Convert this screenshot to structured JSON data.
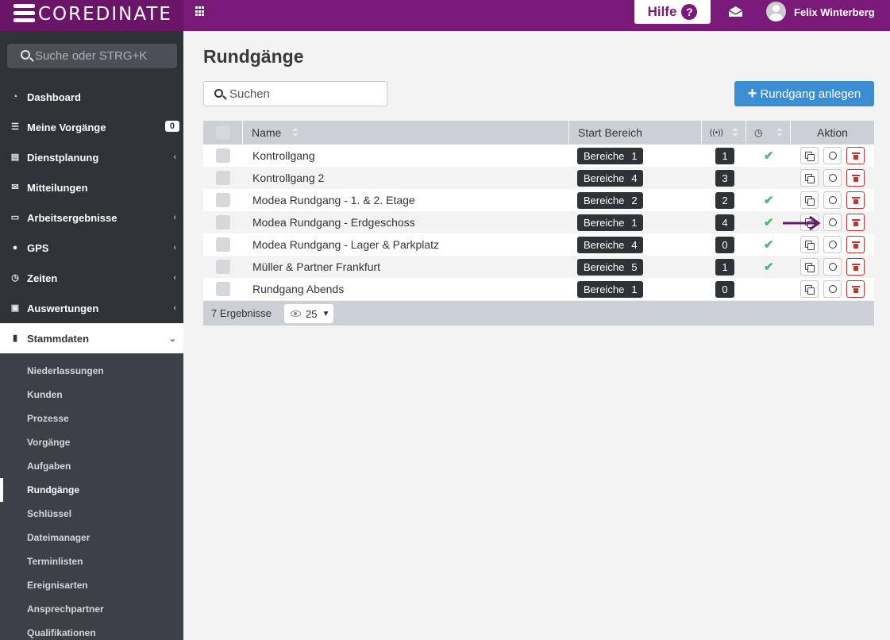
{
  "header": {
    "brand": "COREDINATE",
    "help_label": "Hilfe",
    "help_icon": "question-circle-icon",
    "user_name": "Felix Winterberg"
  },
  "sidebar": {
    "search_placeholder": "Suche oder STRG+K",
    "items": [
      {
        "label": "Dashboard",
        "icon": "dashboard-icon"
      },
      {
        "label": "Meine Vorgänge",
        "icon": "list-icon",
        "badge": "0"
      },
      {
        "label": "Dienstplanung",
        "icon": "calendar-icon"
      },
      {
        "label": "Mitteilungen",
        "icon": "envelope-icon"
      },
      {
        "label": "Arbeitsergebnisse",
        "icon": "monitor-icon"
      },
      {
        "label": "GPS",
        "icon": "map-marker-icon"
      },
      {
        "label": "Zeiten",
        "icon": "clock-icon"
      },
      {
        "label": "Auswertungen",
        "icon": "report-icon"
      },
      {
        "label": "Stammdaten",
        "icon": "book-icon"
      }
    ],
    "subitems": [
      "Niederlassungen",
      "Kunden",
      "Prozesse",
      "Vorgänge",
      "Aufgaben",
      "Rundgänge",
      "Schlüssel",
      "Dateimanager",
      "Terminlisten",
      "Ereignisarten",
      "Ansprechpartner",
      "Qualifikationen"
    ]
  },
  "main": {
    "title": "Rundgänge",
    "search_placeholder": "Suchen",
    "add_button": "Rundgang anlegen",
    "columns": {
      "name": "Name",
      "start": "Start Bereich",
      "signal_icon": "signal-icon",
      "clock_icon": "clock-icon",
      "action": "Aktion"
    },
    "rows": [
      {
        "name": "Kontrollgang",
        "bereiche": "Bereiche",
        "count": "1",
        "signal": "1",
        "active": true
      },
      {
        "name": "Kontrollgang 2",
        "bereiche": "Bereiche",
        "count": "4",
        "signal": "3",
        "active": false
      },
      {
        "name": "Modea Rundgang - 1. & 2. Etage",
        "bereiche": "Bereiche",
        "count": "2",
        "signal": "2",
        "active": true
      },
      {
        "name": "Modea Rundgang - Erdgeschoss",
        "bereiche": "Bereiche",
        "count": "1",
        "signal": "4",
        "active": true
      },
      {
        "name": "Modea Rundgang - Lager & Parkplatz",
        "bereiche": "Bereiche",
        "count": "4",
        "signal": "0",
        "active": true
      },
      {
        "name": "Müller & Partner Frankfurt",
        "bereiche": "Bereiche",
        "count": "5",
        "signal": "1",
        "active": true
      },
      {
        "name": "Rundgang Abends",
        "bereiche": "Bereiche",
        "count": "1",
        "signal": "0",
        "active": false
      }
    ],
    "footer": {
      "results": "7 Ergebnisse",
      "page_size": "25"
    },
    "annotation_color": "#6e1a6c"
  }
}
